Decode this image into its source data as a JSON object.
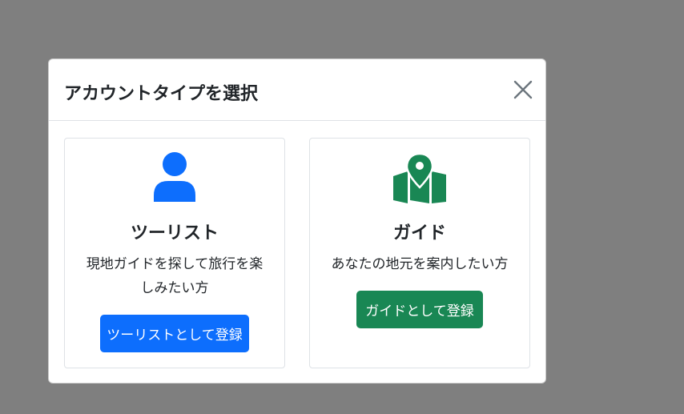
{
  "modal": {
    "title": "アカウントタイプを選択",
    "close_icon": "close-icon"
  },
  "cards": {
    "tourist": {
      "icon": "person-icon",
      "title": "ツーリスト",
      "description": "現地ガイドを探して旅行を楽しみたい方",
      "button_label": "ツーリストとして登録",
      "color": "#0d6efd"
    },
    "guide": {
      "icon": "map-pin-icon",
      "title": "ガイド",
      "description": "あなたの地元を案内したい方",
      "button_label": "ガイドとして登録",
      "color": "#198754"
    }
  },
  "colors": {
    "backdrop": "#7f7f7f",
    "modal_bg": "#ffffff",
    "text": "#212529",
    "border": "#dee2e6"
  }
}
